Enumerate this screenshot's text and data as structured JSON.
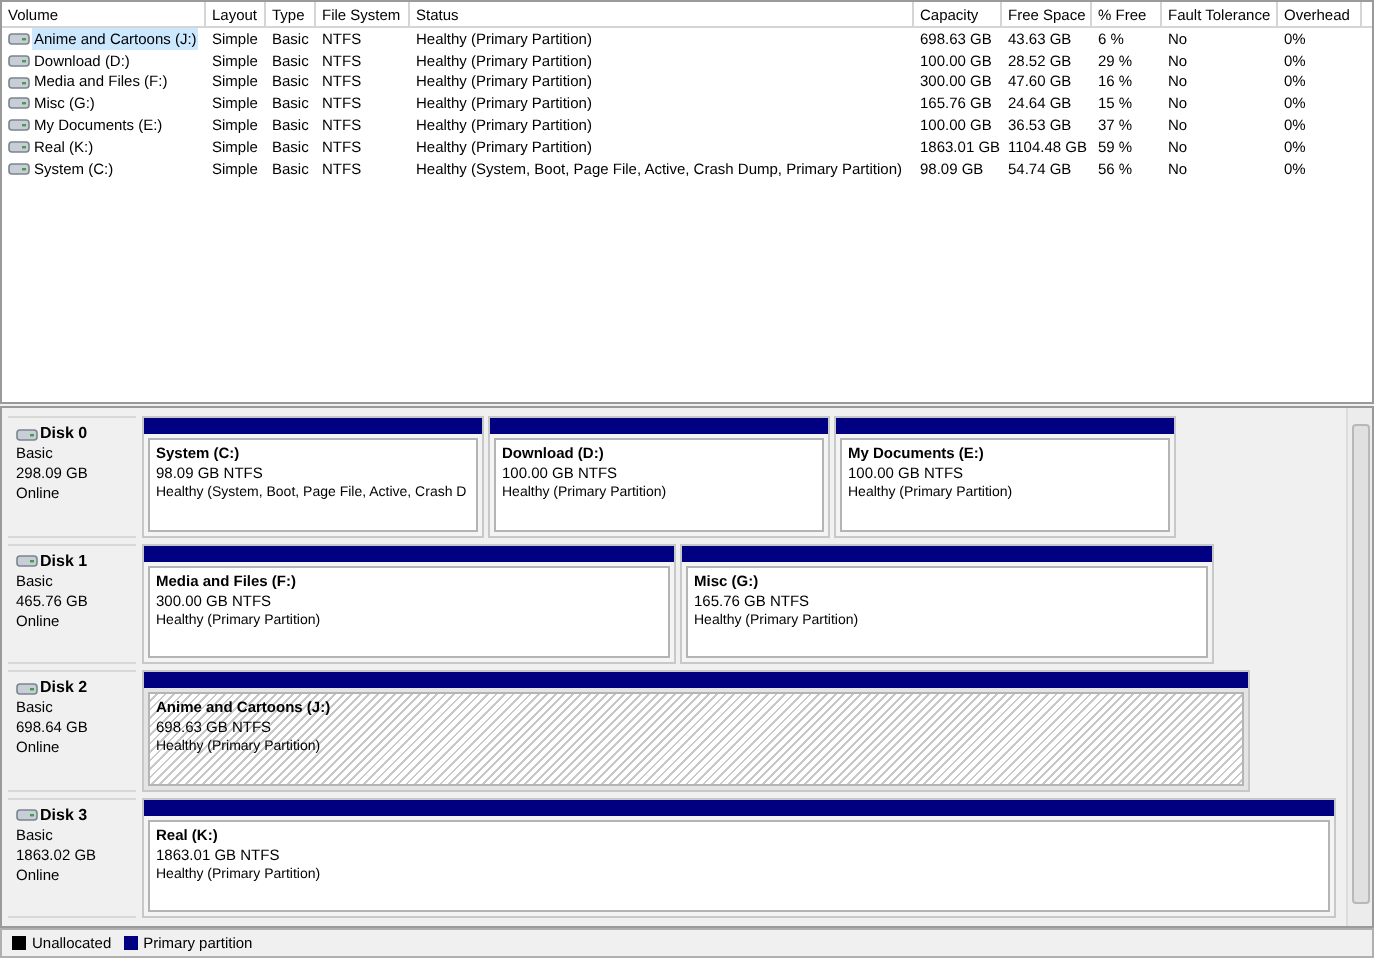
{
  "table": {
    "columns": [
      "Volume",
      "Layout",
      "Type",
      "File System",
      "Status",
      "Capacity",
      "Free Space",
      "% Free",
      "Fault Tolerance",
      "Overhead"
    ],
    "rows": [
      {
        "selected": true,
        "cells": [
          "Anime and Cartoons (J:)",
          "Simple",
          "Basic",
          "NTFS",
          "Healthy (Primary Partition)",
          "698.63 GB",
          "43.63 GB",
          "6 %",
          "No",
          "0%"
        ]
      },
      {
        "selected": false,
        "cells": [
          "Download (D:)",
          "Simple",
          "Basic",
          "NTFS",
          "Healthy (Primary Partition)",
          "100.00 GB",
          "28.52 GB",
          "29 %",
          "No",
          "0%"
        ]
      },
      {
        "selected": false,
        "cells": [
          "Media and Files (F:)",
          "Simple",
          "Basic",
          "NTFS",
          "Healthy (Primary Partition)",
          "300.00 GB",
          "47.60 GB",
          "16 %",
          "No",
          "0%"
        ]
      },
      {
        "selected": false,
        "cells": [
          "Misc (G:)",
          "Simple",
          "Basic",
          "NTFS",
          "Healthy (Primary Partition)",
          "165.76 GB",
          "24.64 GB",
          "15 %",
          "No",
          "0%"
        ]
      },
      {
        "selected": false,
        "cells": [
          "My Documents (E:)",
          "Simple",
          "Basic",
          "NTFS",
          "Healthy (Primary Partition)",
          "100.00 GB",
          "36.53 GB",
          "37 %",
          "No",
          "0%"
        ]
      },
      {
        "selected": false,
        "cells": [
          "Real (K:)",
          "Simple",
          "Basic",
          "NTFS",
          "Healthy (Primary Partition)",
          "1863.01 GB",
          "1104.48 GB",
          "59 %",
          "No",
          "0%"
        ]
      },
      {
        "selected": false,
        "cells": [
          "System (C:)",
          "Simple",
          "Basic",
          "NTFS",
          "Healthy (System, Boot, Page File, Active, Crash Dump, Primary Partition)",
          "98.09 GB",
          "54.74 GB",
          "56 %",
          "No",
          "0%"
        ]
      }
    ]
  },
  "disks": [
    {
      "name": "Disk 0",
      "type": "Basic",
      "size": "298.09 GB",
      "status": "Online",
      "partitions": [
        {
          "name": "System  (C:)",
          "size": "98.09 GB NTFS",
          "status": "Healthy (System, Boot, Page File, Active, Crash D",
          "selected": false
        },
        {
          "name": "Download  (D:)",
          "size": "100.00 GB NTFS",
          "status": "Healthy (Primary Partition)",
          "selected": false
        },
        {
          "name": "My Documents  (E:)",
          "size": "100.00 GB NTFS",
          "status": "Healthy (Primary Partition)",
          "selected": false
        }
      ]
    },
    {
      "name": "Disk 1",
      "type": "Basic",
      "size": "465.76 GB",
      "status": "Online",
      "partitions": [
        {
          "name": "Media and Files  (F:)",
          "size": "300.00 GB NTFS",
          "status": "Healthy (Primary Partition)",
          "selected": false
        },
        {
          "name": "Misc  (G:)",
          "size": "165.76 GB NTFS",
          "status": "Healthy (Primary Partition)",
          "selected": false
        }
      ]
    },
    {
      "name": "Disk 2",
      "type": "Basic",
      "size": "698.64 GB",
      "status": "Online",
      "partitions": [
        {
          "name": "Anime and Cartoons  (J:)",
          "size": "698.63 GB NTFS",
          "status": "Healthy (Primary Partition)",
          "selected": true
        }
      ]
    },
    {
      "name": "Disk 3",
      "type": "Basic",
      "size": "1863.02 GB",
      "status": "Online",
      "partitions": [
        {
          "name": "Real  (K:)",
          "size": "1863.01 GB NTFS",
          "status": "Healthy (Primary Partition)",
          "selected": false
        }
      ]
    }
  ],
  "legend": [
    {
      "label": "Unallocated",
      "color": "#000000"
    },
    {
      "label": "Primary partition",
      "color": "#000080"
    }
  ]
}
